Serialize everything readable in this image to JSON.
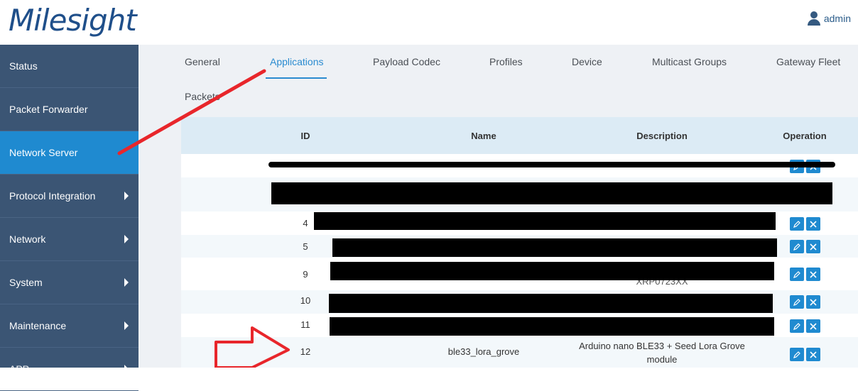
{
  "brand": {
    "logo_text": "Milesight"
  },
  "user": {
    "name": "admin"
  },
  "sidebar": {
    "items": [
      {
        "label": "Status"
      },
      {
        "label": "Packet Forwarder"
      },
      {
        "label": "Network Server"
      },
      {
        "label": "Protocol Integration"
      },
      {
        "label": "Network"
      },
      {
        "label": "System"
      },
      {
        "label": "Maintenance"
      },
      {
        "label": "APP"
      }
    ]
  },
  "tabs": [
    {
      "label": "General"
    },
    {
      "label": "Applications"
    },
    {
      "label": "Payload Codec"
    },
    {
      "label": "Profiles"
    },
    {
      "label": "Device"
    },
    {
      "label": "Multicast Groups"
    },
    {
      "label": "Gateway Fleet"
    },
    {
      "label": "Packets"
    }
  ],
  "table": {
    "headers": {
      "id": "ID",
      "name": "Name",
      "description": "Description",
      "operation": "Operation"
    },
    "rows": [
      {
        "id": "",
        "name": "",
        "description": ""
      },
      {
        "id": "",
        "name": "",
        "description": ""
      },
      {
        "id": "4",
        "name": "",
        "description": ""
      },
      {
        "id": "5",
        "name": "",
        "description": ""
      },
      {
        "id": "9",
        "name": "",
        "description": "XRP0723XX"
      },
      {
        "id": "10",
        "name": "",
        "description": ""
      },
      {
        "id": "11",
        "name": "",
        "description": ""
      },
      {
        "id": "12",
        "name": "ble33_lora_grove",
        "description_line1": "Arduino nano BLE33 + Seed Lora Grove",
        "description_line2": "module"
      }
    ]
  },
  "colors": {
    "sidebar_bg": "#3b5574",
    "active_blue": "#1f8ad0",
    "annotation_red": "#e8262b"
  }
}
